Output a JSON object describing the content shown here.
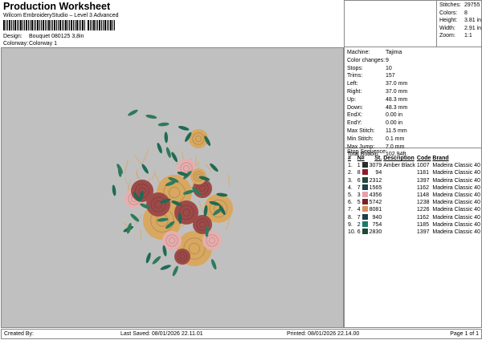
{
  "header": {
    "title": "Production Worksheet",
    "subtitle": "Wilcom EmbroideryStudio – Level 3 Advanced",
    "design_label": "Design:",
    "design_value": "Bouquet 080125 3,8in",
    "colorway_label": "Colorway:",
    "colorway_value": "Colorway 1"
  },
  "stats": [
    {
      "k": "Stitches:",
      "v": "29755"
    },
    {
      "k": "Colors:",
      "v": "8"
    },
    {
      "k": "Height:",
      "v": "3.81 in"
    },
    {
      "k": "Width:",
      "v": "2.91 in"
    },
    {
      "k": "Zoom:",
      "v": "1:1"
    }
  ],
  "info": [
    {
      "k": "Machine:",
      "v": "Tajima"
    },
    {
      "k": "Color changes:",
      "v": "9"
    },
    {
      "k": "Stops:",
      "v": "10"
    },
    {
      "k": "Trims:",
      "v": "157"
    },
    {
      "k": "Left:",
      "v": "37.0 mm"
    },
    {
      "k": "Right:",
      "v": "37.0 mm"
    },
    {
      "k": "Up:",
      "v": "48.3 mm"
    },
    {
      "k": "Down:",
      "v": "48.3 mm"
    },
    {
      "k": "EndX:",
      "v": "0.00 in"
    },
    {
      "k": "EndY:",
      "v": "0.00 in"
    },
    {
      "k": "Max Stitch:",
      "v": "11.5 mm"
    },
    {
      "k": "Min Stitch:",
      "v": "0.1 mm"
    },
    {
      "k": "Max Jump:",
      "v": "7.0 mm"
    },
    {
      "k": "Total Bobbin:",
      "v": "102.94ft"
    }
  ],
  "sequence": {
    "title": "Stop Sequence:",
    "headers": [
      "#",
      "N#",
      "St.",
      "Description",
      "Code",
      "Brand"
    ],
    "rows": [
      {
        "i": "1.",
        "n": "1",
        "color": "#2b2b2b",
        "st": "3079",
        "desc": "Amber Black",
        "code": "1007",
        "brand": "Madeira Classic 40"
      },
      {
        "i": "2.",
        "n": "8",
        "color": "#8e1b2c",
        "st": "94",
        "desc": "",
        "code": "1181",
        "brand": "Madeira Classic 40"
      },
      {
        "i": "3.",
        "n": "6",
        "color": "#1f4a3a",
        "st": "2312",
        "desc": "",
        "code": "1397",
        "brand": "Madeira Classic 40"
      },
      {
        "i": "4.",
        "n": "7",
        "color": "#1f3f4a",
        "st": "1565",
        "desc": "",
        "code": "1162",
        "brand": "Madeira Classic 40"
      },
      {
        "i": "5.",
        "n": "3",
        "color": "#e8a0a8",
        "st": "4356",
        "desc": "",
        "code": "1148",
        "brand": "Madeira Classic 40"
      },
      {
        "i": "6.",
        "n": "5",
        "color": "#7a1f2a",
        "st": "5742",
        "desc": "",
        "code": "1238",
        "brand": "Madeira Classic 40"
      },
      {
        "i": "7.",
        "n": "4",
        "color": "#d9905e",
        "st": "8081",
        "desc": "",
        "code": "1226",
        "brand": "Madeira Classic 40"
      },
      {
        "i": "8.",
        "n": "7",
        "color": "#1f3f4a",
        "st": "940",
        "desc": "",
        "code": "1162",
        "brand": "Madeira Classic 40"
      },
      {
        "i": "9.",
        "n": "2",
        "color": "#1a7a6a",
        "st": "754",
        "desc": "",
        "code": "1185",
        "brand": "Madeira Classic 40"
      },
      {
        "i": "10.",
        "n": "6",
        "color": "#1f4a3a",
        "st": "2830",
        "desc": "",
        "code": "1397",
        "brand": "Madeira Classic 40"
      }
    ]
  },
  "footer": {
    "created": "Created By:",
    "saved": "Last Saved: 08/01/2026 22.11.01",
    "printed": "Printed: 08/01/2026 22.14.00",
    "page": "Page 1 of 1"
  }
}
